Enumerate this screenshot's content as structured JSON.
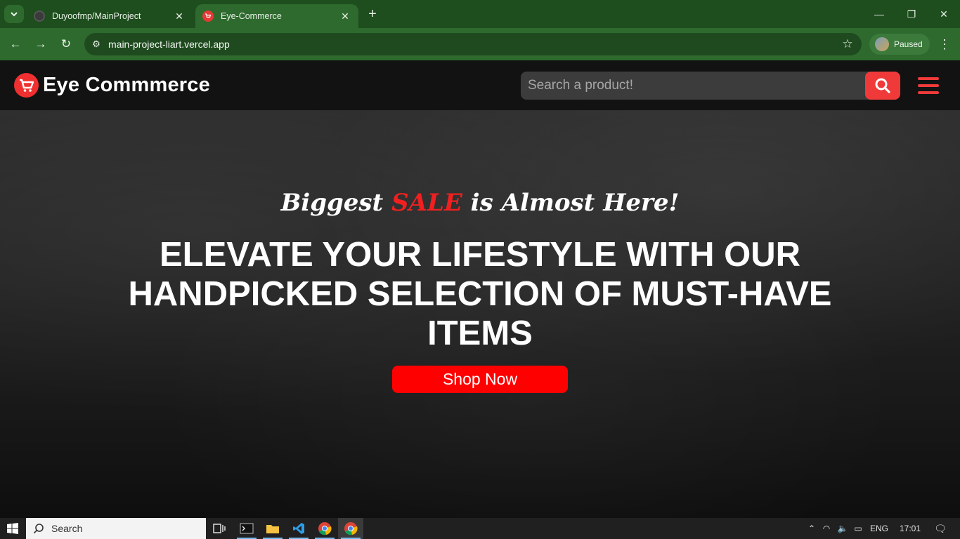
{
  "browser": {
    "tabs": [
      {
        "title": "Duyoofmp/MainProject",
        "favicon": "github-icon",
        "active": false
      },
      {
        "title": "Eye-Commerce",
        "favicon": "cart-icon",
        "active": true
      }
    ],
    "url": "main-project-liart.vercel.app",
    "profile_status": "Paused"
  },
  "site": {
    "logo_text": "Eye Commmerce",
    "search_placeholder": "Search a product!",
    "accent_color": "#f03a3a"
  },
  "hero": {
    "tagline_before": "Biggest ",
    "tagline_highlight": "SALE",
    "tagline_after": " is Almost Here!",
    "title": "ELEVATE YOUR LIFESTYLE WITH OUR HANDPICKED SELECTION OF MUST-HAVE ITEMS",
    "cta": "Shop Now"
  },
  "taskbar": {
    "search_label": "Search",
    "language": "ENG",
    "time": "17:01"
  }
}
